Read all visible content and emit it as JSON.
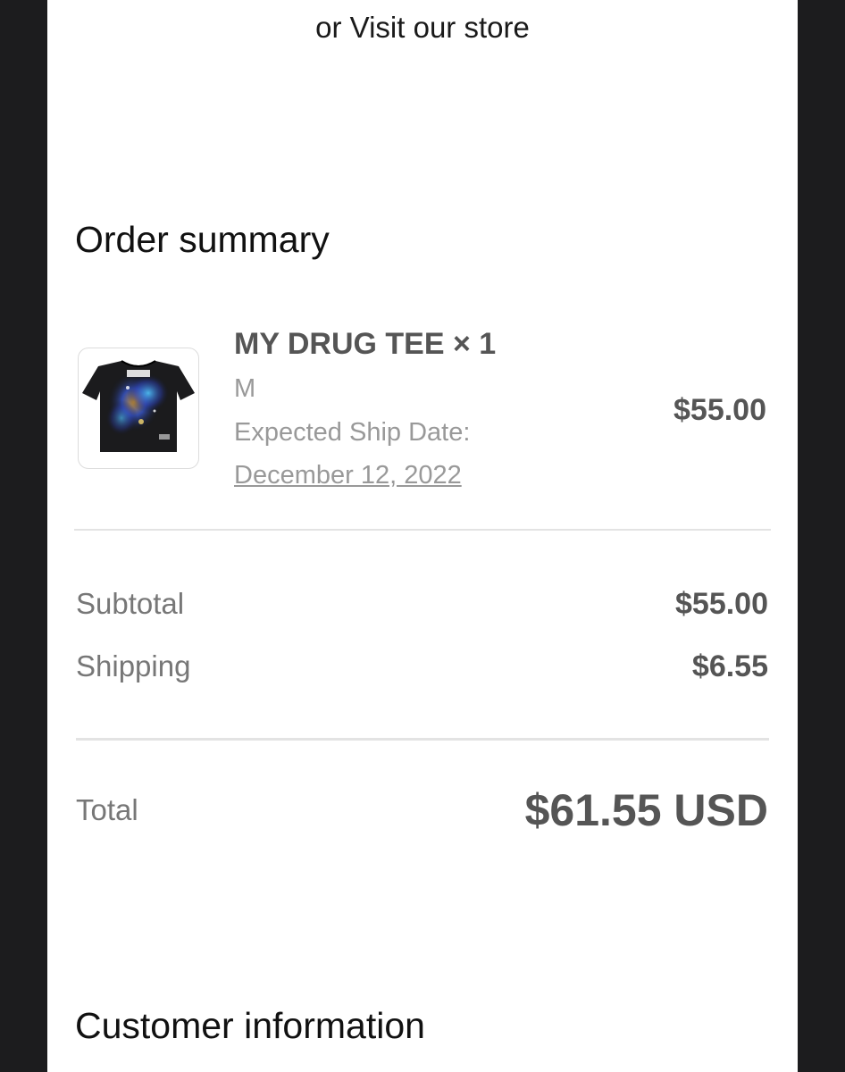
{
  "header": {
    "store_link": "or Visit our store"
  },
  "order_summary": {
    "title": "Order summary",
    "item": {
      "image_icon": "tshirt-product-image",
      "name": "MY DRUG TEE × 1",
      "variant": "M",
      "ship_label": "Expected Ship Date:",
      "ship_date": "December 12, 2022",
      "price": "$55.00"
    },
    "subtotal": {
      "label": "Subtotal",
      "value": "$55.00"
    },
    "shipping": {
      "label": "Shipping",
      "value": "$6.55"
    },
    "total": {
      "label": "Total",
      "value": "$61.55 USD"
    }
  },
  "customer_information": {
    "title": "Customer information"
  },
  "colors": {
    "background": "#1c1c1e",
    "card": "#ffffff",
    "primary_text": "#111111",
    "secondary_text": "#555555",
    "muted_text": "#999999",
    "divider": "#e3e3e3"
  }
}
